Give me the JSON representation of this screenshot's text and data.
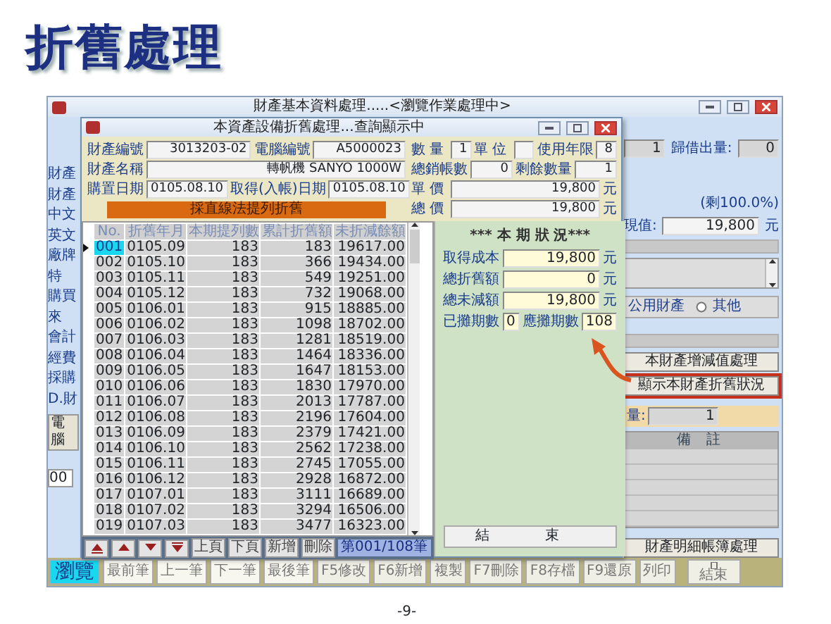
{
  "page_title": "折舊處理",
  "main_window": {
    "title": "財產基本資料處理.....<瀏覽作業處理中>",
    "side_labels": [
      "財產",
      "財產",
      "中文",
      "英文",
      "廠牌",
      "特",
      "購買",
      "來",
      "會計",
      "經費",
      "採購",
      "D.財"
    ],
    "side_button": "電腦",
    "side_cell": "00",
    "counts": [
      {
        "value": "1"
      },
      {
        "label": "歸借出量:",
        "value": "0"
      }
    ],
    "remaining": "(剩100.0%)",
    "current_value": {
      "label": "現值:",
      "value": "19,800",
      "unit": "元"
    },
    "property_type": {
      "label": "公用財產",
      "radio": {
        "label": "其他",
        "selected": false
      }
    },
    "action_buttons": [
      {
        "label": "本財產增減值處理",
        "highlighted": false
      },
      {
        "label": "顯示本財產折舊狀況",
        "highlighted": true
      }
    ],
    "quantity": {
      "label": "量:",
      "value": "1"
    },
    "remarks_header": "備 註",
    "ledger_button": "財產明細帳簿處理",
    "toolbar": [
      {
        "label": "瀏覽",
        "kind": "mode"
      },
      {
        "label": "最前筆",
        "kind": "nav"
      },
      {
        "label": "上一筆",
        "kind": "nav"
      },
      {
        "label": "下一筆",
        "kind": "nav"
      },
      {
        "label": "最後筆",
        "kind": "nav"
      },
      {
        "label": "F5修改",
        "kind": "action"
      },
      {
        "label": "F6新增",
        "kind": "action"
      },
      {
        "label": "複製",
        "kind": "action"
      },
      {
        "label": "F7刪除",
        "kind": "action"
      },
      {
        "label": "F8存檔",
        "kind": "action"
      },
      {
        "label": "F9還原",
        "kind": "action"
      },
      {
        "label": "列印",
        "kind": "action"
      },
      {
        "label": "結束",
        "kind": "exit"
      }
    ]
  },
  "dialog": {
    "title": "本資產設備折舊處理...查詢顯示中",
    "form_rows": [
      {
        "left": [
          {
            "kind": "field",
            "label": "財產編號",
            "value": "3013203-02"
          },
          {
            "kind": "field",
            "label": "電腦編號",
            "value": "A5000023"
          }
        ],
        "right": [
          {
            "label": "數量",
            "value": "1"
          },
          {
            "label": "單位"
          },
          {
            "label": "使用年限",
            "value": "8"
          }
        ]
      },
      {
        "left": [
          {
            "kind": "field",
            "label": "財產名稱",
            "value": "轉帆機 SANYO 1000W"
          }
        ],
        "right": [
          {
            "label": "總銷帳數",
            "value": "0"
          },
          {
            "label": "剩餘數量",
            "value": "1"
          }
        ]
      },
      {
        "left": [
          {
            "kind": "field",
            "label": "購置日期",
            "value": "0105.08.10"
          },
          {
            "kind": "field",
            "label": "取得(入帳)日期",
            "value": "0105.08.10"
          }
        ],
        "right": [
          {
            "label": "單價",
            "value": "19,800",
            "unit": "元"
          }
        ]
      },
      {
        "left": [
          {
            "kind": "banner",
            "label": "採直線法提列折舊"
          }
        ],
        "right": [
          {
            "label": "總價",
            "value": "19,800",
            "unit": "元"
          }
        ]
      }
    ],
    "table": {
      "columns": [
        "No.",
        "折舊年月",
        "本期提列數",
        "累計折舊額",
        "未折減餘額"
      ],
      "rows": [
        {
          "cells": [
            "001",
            "0105.09",
            "183",
            "183",
            "19617.00"
          ],
          "selected": true
        },
        {
          "cells": [
            "002",
            "0105.10",
            "183",
            "366",
            "19434.00"
          ],
          "selected": false
        },
        {
          "cells": [
            "003",
            "0105.11",
            "183",
            "549",
            "19251.00"
          ],
          "selected": false
        },
        {
          "cells": [
            "004",
            "0105.12",
            "183",
            "732",
            "19068.00"
          ],
          "selected": false
        },
        {
          "cells": [
            "005",
            "0106.01",
            "183",
            "915",
            "18885.00"
          ],
          "selected": false
        },
        {
          "cells": [
            "006",
            "0106.02",
            "183",
            "1098",
            "18702.00"
          ],
          "selected": false
        },
        {
          "cells": [
            "007",
            "0106.03",
            "183",
            "1281",
            "18519.00"
          ],
          "selected": false
        },
        {
          "cells": [
            "008",
            "0106.04",
            "183",
            "1464",
            "18336.00"
          ],
          "selected": false
        },
        {
          "cells": [
            "009",
            "0106.05",
            "183",
            "1647",
            "18153.00"
          ],
          "selected": false
        },
        {
          "cells": [
            "010",
            "0106.06",
            "183",
            "1830",
            "17970.00"
          ],
          "selected": false
        },
        {
          "cells": [
            "011",
            "0106.07",
            "183",
            "2013",
            "17787.00"
          ],
          "selected": false
        },
        {
          "cells": [
            "012",
            "0106.08",
            "183",
            "2196",
            "17604.00"
          ],
          "selected": false
        },
        {
          "cells": [
            "013",
            "0106.09",
            "183",
            "2379",
            "17421.00"
          ],
          "selected": false
        },
        {
          "cells": [
            "014",
            "0106.10",
            "183",
            "2562",
            "17238.00"
          ],
          "selected": false
        },
        {
          "cells": [
            "015",
            "0106.11",
            "183",
            "2745",
            "17055.00"
          ],
          "selected": false
        },
        {
          "cells": [
            "016",
            "0106.12",
            "183",
            "2928",
            "16872.00"
          ],
          "selected": false
        },
        {
          "cells": [
            "017",
            "0107.01",
            "183",
            "3111",
            "16689.00"
          ],
          "selected": false
        },
        {
          "cells": [
            "018",
            "0107.02",
            "183",
            "3294",
            "16506.00"
          ],
          "selected": false
        },
        {
          "cells": [
            "019",
            "0107.03",
            "183",
            "3477",
            "16323.00"
          ],
          "selected": false
        }
      ]
    },
    "nav_buttons": [
      "上頁",
      "下頁",
      "新增",
      "刪除"
    ],
    "record_counter": "第001/108筆",
    "status": {
      "title": "*** 本 期 狀 況***",
      "amounts": [
        {
          "label": "取得成本",
          "value": "19,800",
          "unit": "元"
        },
        {
          "label": "總折舊額",
          "value": "0",
          "unit": "元"
        },
        {
          "label": "總未減額",
          "value": "19,800",
          "unit": "元"
        }
      ],
      "periods": [
        {
          "label": "已攤期數",
          "value": "0"
        },
        {
          "label": "應攤期數",
          "value": "108"
        }
      ]
    },
    "close_button": "結 束"
  },
  "page_number": "-9-"
}
